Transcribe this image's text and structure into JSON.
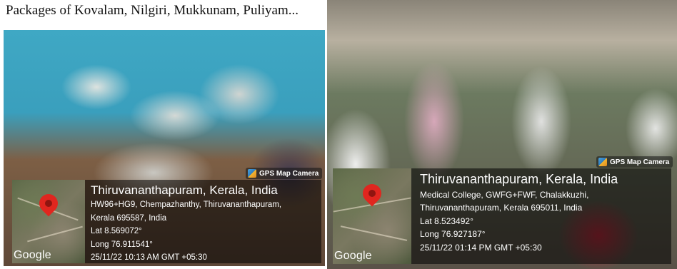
{
  "caption": "Packages of Kovalam, Nilgiri, Mukkunam, Puliyam...",
  "left_photo": {
    "badge": "GPS Map Camera",
    "map_label": "Google",
    "location_title": "Thiruvananthapuram, Kerala, India",
    "address_line1": "HW96+HG9, Chempazhanthy, Thiruvananthapuram,",
    "address_line2": "Kerala 695587, India",
    "lat": "Lat 8.569072°",
    "long": "Long 76.911541°",
    "datetime": "25/11/22 10:13 AM GMT +05:30"
  },
  "right_photo": {
    "badge": "GPS Map Camera",
    "map_label": "Google",
    "location_title": "Thiruvananthapuram, Kerala, India",
    "address_line1": "Medical College, GWFG+FWF, Chalakkuzhi,",
    "address_line2": "Thiruvananthapuram, Kerala 695011, India",
    "lat": "Lat 8.523492°",
    "long": "Long 76.927187°",
    "datetime": "25/11/22 01:14 PM GMT +05:30"
  },
  "colors": {
    "pin": "#e0261f",
    "overlay": "rgba(0,0,0,0.55)"
  }
}
